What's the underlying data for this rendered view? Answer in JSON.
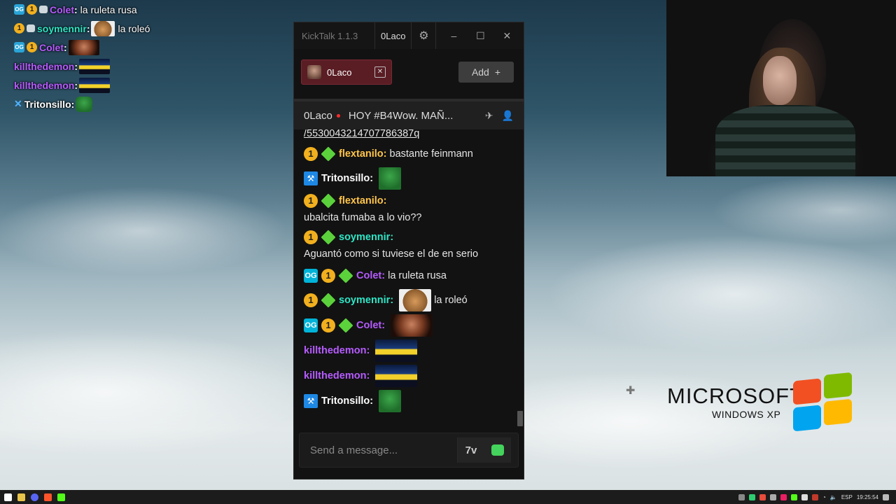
{
  "overlay_chat": [
    {
      "badges": [
        "og",
        "sub",
        "chat"
      ],
      "user": "Colet",
      "color": "#b65cff",
      "message": "la ruleta rusa",
      "emote": null
    },
    {
      "badges": [
        "sub",
        "chat"
      ],
      "user": "soymennir",
      "color": "#2ee6c6",
      "message": "la roleó",
      "emote": "dog"
    },
    {
      "badges": [
        "og",
        "sub"
      ],
      "user": "Colet",
      "color": "#b65cff",
      "message": "",
      "emote": "face"
    },
    {
      "badges": [],
      "user": "killthedemon",
      "color": "#b65cff",
      "message": "",
      "emote": "car"
    },
    {
      "badges": [],
      "user": "killthedemon",
      "color": "#b65cff",
      "message": "",
      "emote": "car"
    },
    {
      "badges": [
        "mod"
      ],
      "user": "Tritonsillo",
      "color": "#ffffff",
      "message": "",
      "emote": "pepe"
    }
  ],
  "window": {
    "app_title": "KickTalk 1.1.3",
    "user": "0Laco",
    "minimize": "–",
    "maximize": "☐",
    "close": "✕"
  },
  "tabs": {
    "active_tab": "0Laco",
    "add_label": "Add",
    "add_icon": "+"
  },
  "channel": {
    "name": "0Laco",
    "stream_title": "HOY #B4Wow. MAÑ..."
  },
  "chat": {
    "partial_link": "/5530043214707786387q",
    "messages": [
      {
        "badges": [
          "sub",
          "gem"
        ],
        "user": "flextanilo",
        "color": "#ffc54a",
        "text": "bastante feinmann",
        "emote": null
      },
      {
        "badges": [
          "mod"
        ],
        "user": "Tritonsillo",
        "color": "#ffffff",
        "text": "",
        "emote": "pepe"
      },
      {
        "badges": [
          "sub",
          "gem"
        ],
        "user": "flextanilo",
        "color": "#ffc54a",
        "text": "ubalcita fumaba a lo vio??",
        "emote": null
      },
      {
        "badges": [
          "sub",
          "gem"
        ],
        "user": "soymennir",
        "color": "#2ee6c6",
        "text": "Aguantó como si tuviese el      de en serio",
        "emote": null
      },
      {
        "badges": [
          "og",
          "sub",
          "gem"
        ],
        "user": "Colet",
        "color": "#b65cff",
        "text": "la ruleta rusa",
        "emote": null
      },
      {
        "badges": [
          "sub",
          "gem"
        ],
        "user": "soymennir",
        "color": "#2ee6c6",
        "text": "la roleó",
        "emote": "dog"
      },
      {
        "badges": [
          "og",
          "sub",
          "gem"
        ],
        "user": "Colet",
        "color": "#b65cff",
        "text": "",
        "emote": "face"
      },
      {
        "badges": [],
        "user": "killthedemon",
        "color": "#b65cff",
        "text": "",
        "emote": "car"
      },
      {
        "badges": [],
        "user": "killthedemon",
        "color": "#b65cff",
        "text": "",
        "emote": "car"
      },
      {
        "badges": [
          "mod"
        ],
        "user": "Tritonsillo",
        "color": "#ffffff",
        "text": "",
        "emote": "pepe"
      }
    ]
  },
  "input": {
    "placeholder": "Send a message..."
  },
  "desktop": {
    "brand": "MICROSOFT",
    "product": "WINDOWS XP"
  },
  "taskbar": {
    "lang": "ESP",
    "time": "19:25:54"
  }
}
